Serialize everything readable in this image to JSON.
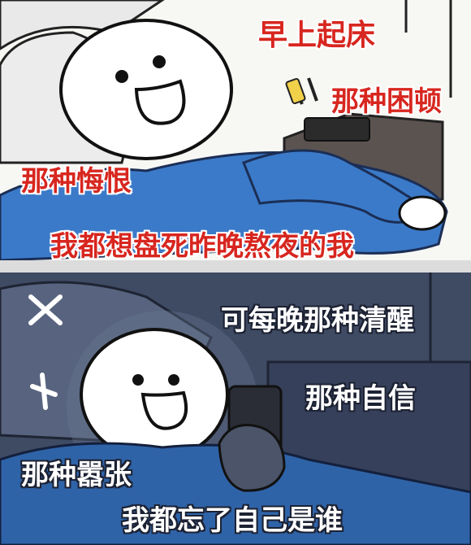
{
  "top_panel": {
    "captions": {
      "morning": "早上起床",
      "sudden": "那种困顿",
      "regret": "那种悔恨",
      "kill_self": "我都想盘死昨晚熬夜的我"
    }
  },
  "bottom_panel": {
    "captions": {
      "sober": "可每晚那种清醒",
      "confident": "那种自信",
      "arrogant": "那种嚣张",
      "forget": "我都忘了自己是谁"
    }
  },
  "colors": {
    "top_caption": "#d7261f",
    "bottom_caption": "#ffffff",
    "blanket": "#3b7ac9",
    "night_bg": "#3f4a63"
  }
}
